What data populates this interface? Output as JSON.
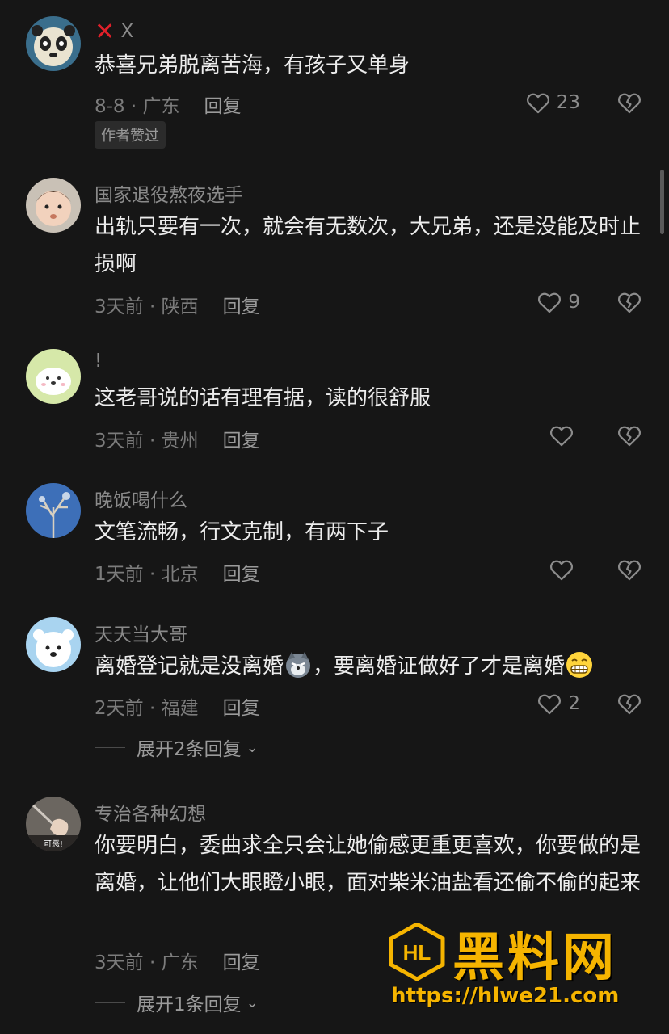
{
  "comments": [
    {
      "username": "X",
      "text": "恭喜兄弟脱离苦海，有孩子又单身",
      "meta": "8-8 · 广东",
      "reply": "回复",
      "likes": "23",
      "tag": "作者赞过"
    },
    {
      "username": "国家退役熬夜选手",
      "text": "出轨只要有一次，就会有无数次，大兄弟，还是没能及时止损啊",
      "meta": "3天前 · 陕西",
      "reply": "回复",
      "likes": "9"
    },
    {
      "username": "!",
      "text": "这老哥说的话有理有据，读的很舒服",
      "meta": "3天前 · 贵州",
      "reply": "回复",
      "likes": ""
    },
    {
      "username": "晚饭喝什么",
      "text": "文笔流畅，行文克制，有两下子",
      "meta": "1天前 · 北京",
      "reply": "回复",
      "likes": ""
    },
    {
      "username": "天天当大哥",
      "text_a": "离婚登记就是没离婚",
      "text_b": "，要离婚证做好了才是离婚",
      "meta": "2天前 · 福建",
      "reply": "回复",
      "likes": "2",
      "expand": "展开2条回复"
    },
    {
      "username": "专治各种幻想",
      "text": "你要明白，委曲求全只会让她偷感更重更喜欢，你要做的是离婚，让他们大眼瞪小眼，面对柴米油盐看还偷不偷的起来",
      "meta": "3天前 · 广东",
      "reply": "回复",
      "likes": "",
      "expand": "展开1条回复",
      "avatar_caption": "可恶!"
    }
  ],
  "watermark": {
    "title": "黑料网",
    "url": "https://hlwe21.com",
    "logo": "HL"
  },
  "icons": {
    "like": "heart-outline-icon",
    "dislike": "broken-heart-icon",
    "expand": "chevron-down-icon"
  },
  "colors": {
    "background": "#161616",
    "watermark": "#f5b400",
    "cross": "#e0202a"
  }
}
